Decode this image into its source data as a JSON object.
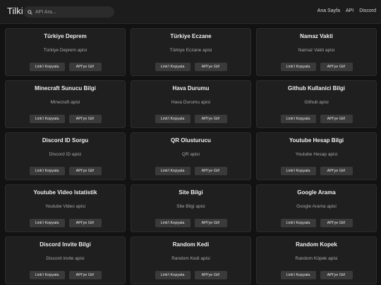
{
  "header": {
    "brand": "Tilki",
    "search_placeholder": "API Ara...",
    "nav": [
      "Ana Sayfa",
      "API",
      "Discord"
    ]
  },
  "buttons": {
    "copy": "Link'i Kopyala",
    "go": "API'ye Git!"
  },
  "cards": [
    {
      "title": "Türkiye Deprem",
      "desc": "Türkiye Deprem apisi"
    },
    {
      "title": "Türkiye Eczane",
      "desc": "Türkiye Eczane apisi"
    },
    {
      "title": "Namaz Vakti",
      "desc": "Namaz Vakti apisi"
    },
    {
      "title": "Minecraft Sunucu Bilgi",
      "desc": "Minecraft apisi"
    },
    {
      "title": "Hava Durumu",
      "desc": "Hava Durumu apisi"
    },
    {
      "title": "Github Kullanici Bilgi",
      "desc": "Github apisi"
    },
    {
      "title": "Discord ID Sorgu",
      "desc": "Discord ID apisi"
    },
    {
      "title": "QR Olusturucu",
      "desc": "QR apisi"
    },
    {
      "title": "Youtube Hesap Bilgi",
      "desc": "Youtube Hesap apisi"
    },
    {
      "title": "Youtube Video Istatistik",
      "desc": "Youtube Video apisi"
    },
    {
      "title": "Site Bilgi",
      "desc": "Site Bilgi apisi"
    },
    {
      "title": "Google Arama",
      "desc": "Google Arama apisi"
    },
    {
      "title": "Discord Invite Bilgi",
      "desc": "Discord invite apisi"
    },
    {
      "title": "Random Kedi",
      "desc": "Random Kedi apisi"
    },
    {
      "title": "Random Kopek",
      "desc": "Random Köpek apisi"
    }
  ]
}
